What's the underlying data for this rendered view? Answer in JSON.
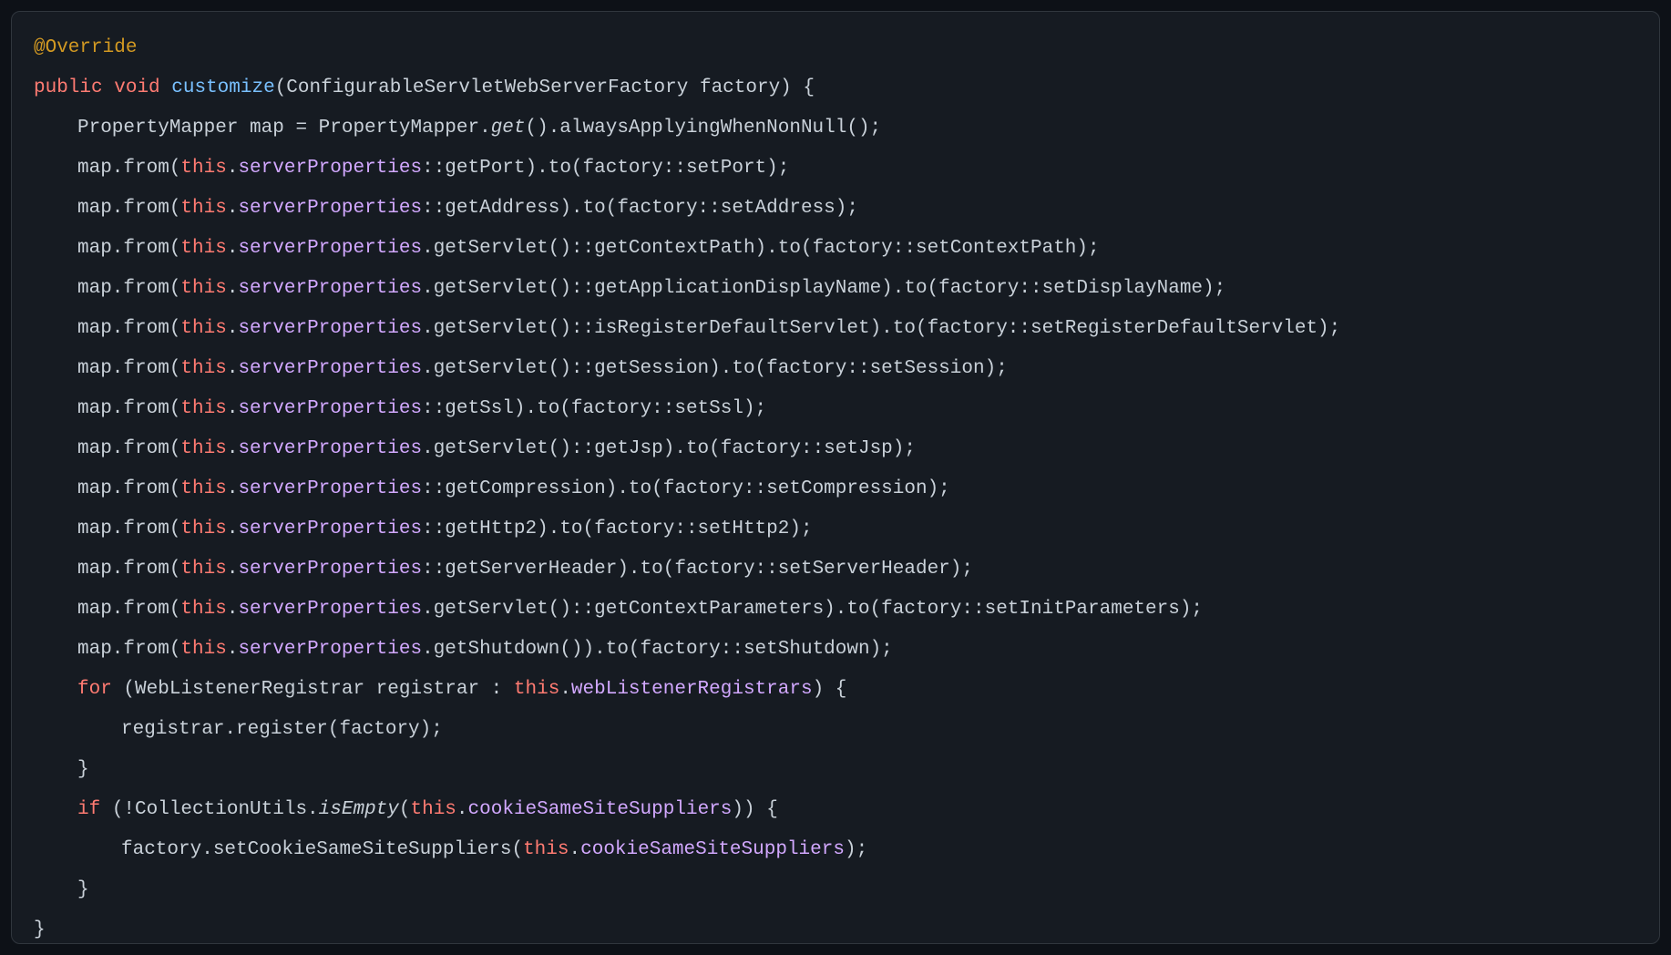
{
  "annotation": "@Override",
  "kw": {
    "public": "public",
    "void": "void",
    "this": "this",
    "for": "for",
    "if": "if"
  },
  "fn": {
    "customize": "customize"
  },
  "sig": {
    "params": "(ConfigurableServletWebServerFactory factory) {"
  },
  "body": {
    "mapperDecl": "PropertyMapper map = PropertyMapper.",
    "get": "get",
    "mapperTail": "().alwaysApplyingWhenNonNull();",
    "mapFromOpen": "map.from(",
    "dot": ".",
    "sp": "serverProperties",
    "port": "::getPort).to(factory::setPort);",
    "address": "::getAddress).to(factory::setAddress);",
    "contextPath": ".getServlet()::getContextPath).to(factory::setContextPath);",
    "displayName": ".getServlet()::getApplicationDisplayName).to(factory::setDisplayName);",
    "regDefault": ".getServlet()::isRegisterDefaultServlet).to(factory::setRegisterDefaultServlet);",
    "session": ".getServlet()::getSession).to(factory::setSession);",
    "ssl": "::getSsl).to(factory::setSsl);",
    "jsp": ".getServlet()::getJsp).to(factory::setJsp);",
    "compression": "::getCompression).to(factory::setCompression);",
    "http2": "::getHttp2).to(factory::setHttp2);",
    "serverHeader": "::getServerHeader).to(factory::setServerHeader);",
    "contextParams": ".getServlet()::getContextParameters).to(factory::setInitParameters);",
    "shutdown": ".getShutdown()).to(factory::setShutdown);",
    "forMid": " (WebListenerRegistrar registrar : ",
    "wlr": "webListenerRegistrars",
    "forClose": ") {",
    "registrarCall": "registrar.register(factory);",
    "closeBrace": "}",
    "ifMid1": " (!CollectionUtils.",
    "isEmpty": "isEmpty",
    "ifMid2": "(",
    "csss": "cookieSameSiteSuppliers",
    "ifClose": ")) {",
    "setCookieHead": "factory.setCookieSameSiteSuppliers(",
    "setCookieTail": ");"
  }
}
